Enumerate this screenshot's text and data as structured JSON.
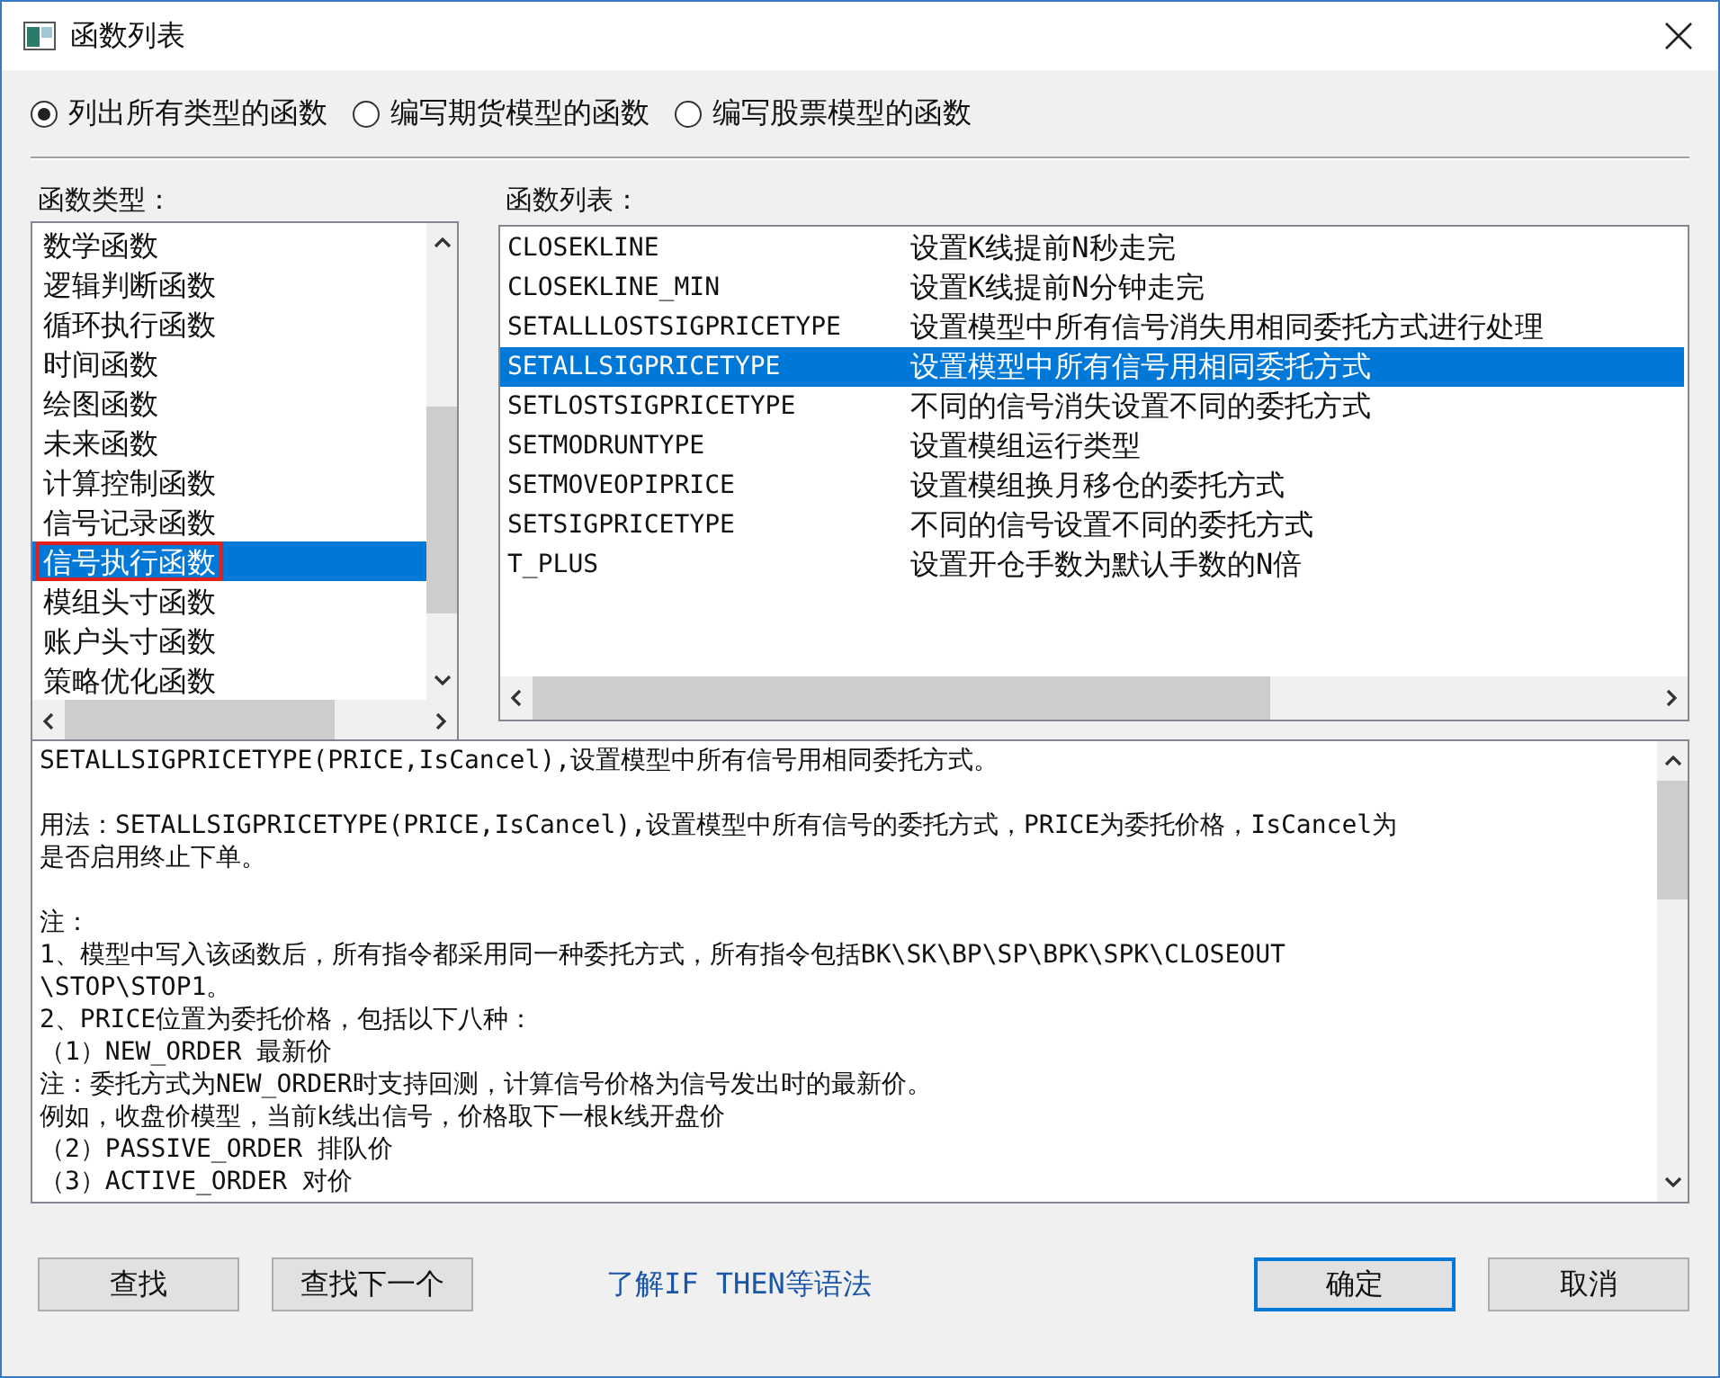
{
  "window": {
    "title": "函数列表"
  },
  "modes": [
    {
      "label": "列出所有类型的函数",
      "selected": true
    },
    {
      "label": "编写期货模型的函数",
      "selected": false
    },
    {
      "label": "编写股票模型的函数",
      "selected": false
    }
  ],
  "category_list": {
    "label": "函数类型：",
    "items": [
      {
        "text": "数学函数",
        "selected": false,
        "annotated": false
      },
      {
        "text": "逻辑判断函数",
        "selected": false,
        "annotated": false
      },
      {
        "text": "循环执行函数",
        "selected": false,
        "annotated": false
      },
      {
        "text": "时间函数",
        "selected": false,
        "annotated": false
      },
      {
        "text": "绘图函数",
        "selected": false,
        "annotated": false
      },
      {
        "text": "未来函数",
        "selected": false,
        "annotated": false
      },
      {
        "text": "计算控制函数",
        "selected": false,
        "annotated": false
      },
      {
        "text": "信号记录函数",
        "selected": false,
        "annotated": false
      },
      {
        "text": "信号执行函数",
        "selected": true,
        "annotated": true
      },
      {
        "text": "模组头寸函数",
        "selected": false,
        "annotated": false
      },
      {
        "text": "账户头寸函数",
        "selected": false,
        "annotated": false
      },
      {
        "text": "策略优化函数",
        "selected": false,
        "annotated": false
      }
    ]
  },
  "function_list": {
    "label": "函数列表：",
    "rows": [
      {
        "name": "CLOSEKLINE",
        "description": "设置K线提前N秒走完",
        "selected": false
      },
      {
        "name": "CLOSEKLINE_MIN",
        "description": "设置K线提前N分钟走完",
        "selected": false
      },
      {
        "name": "SETALLLOSTSIGPRICETYPE",
        "description": "设置模型中所有信号消失用相同委托方式进行处理",
        "selected": false
      },
      {
        "name": "SETALLSIGPRICETYPE",
        "description": "设置模型中所有信号用相同委托方式",
        "selected": true
      },
      {
        "name": "SETLOSTSIGPRICETYPE",
        "description": "不同的信号消失设置不同的委托方式",
        "selected": false
      },
      {
        "name": "SETMODRUNTYPE",
        "description": "设置模组运行类型",
        "selected": false
      },
      {
        "name": "SETMOVEOPIPRICE",
        "description": "设置模组换月移仓的委托方式",
        "selected": false
      },
      {
        "name": "SETSIGPRICETYPE",
        "description": "不同的信号设置不同的委托方式",
        "selected": false
      },
      {
        "name": "T_PLUS",
        "description": "设置开仓手数为默认手数的N倍",
        "selected": false
      }
    ]
  },
  "description": {
    "blocks": [
      [
        "SETALLSIGPRICETYPE(PRICE,IsCancel),设置模型中所有信号用相同委托方式。"
      ],
      [
        "用法：SETALLSIGPRICETYPE(PRICE,IsCancel),设置模型中所有信号的委托方式，PRICE为委托价格，IsCancel为",
        "是否启用终止下单。"
      ],
      [
        "注：",
        "1、模型中写入该函数后，所有指令都采用同一种委托方式，所有指令包括BK\\SK\\BP\\SP\\BPK\\SPK\\CLOSEOUT",
        "\\STOP\\STOP1。",
        "2、PRICE位置为委托价格，包括以下八种：",
        "（1）NEW_ORDER 最新价",
        "注：委托方式为NEW_ORDER时支持回测，计算信号价格为信号发出时的最新价。",
        "例如，收盘价模型，当前k线出信号，价格取下一根k线开盘价",
        "（2）PASSIVE_ORDER 排队价",
        "（3）ACTIVE_ORDER 对价"
      ]
    ]
  },
  "footer": {
    "left_buttons": [
      {
        "label": "查找",
        "default": false
      },
      {
        "label": "查找下一个",
        "default": false
      }
    ],
    "link": "了解IF THEN等语法",
    "right_buttons": [
      {
        "label": "确定",
        "default": true
      },
      {
        "label": "取消",
        "default": false
      }
    ]
  }
}
